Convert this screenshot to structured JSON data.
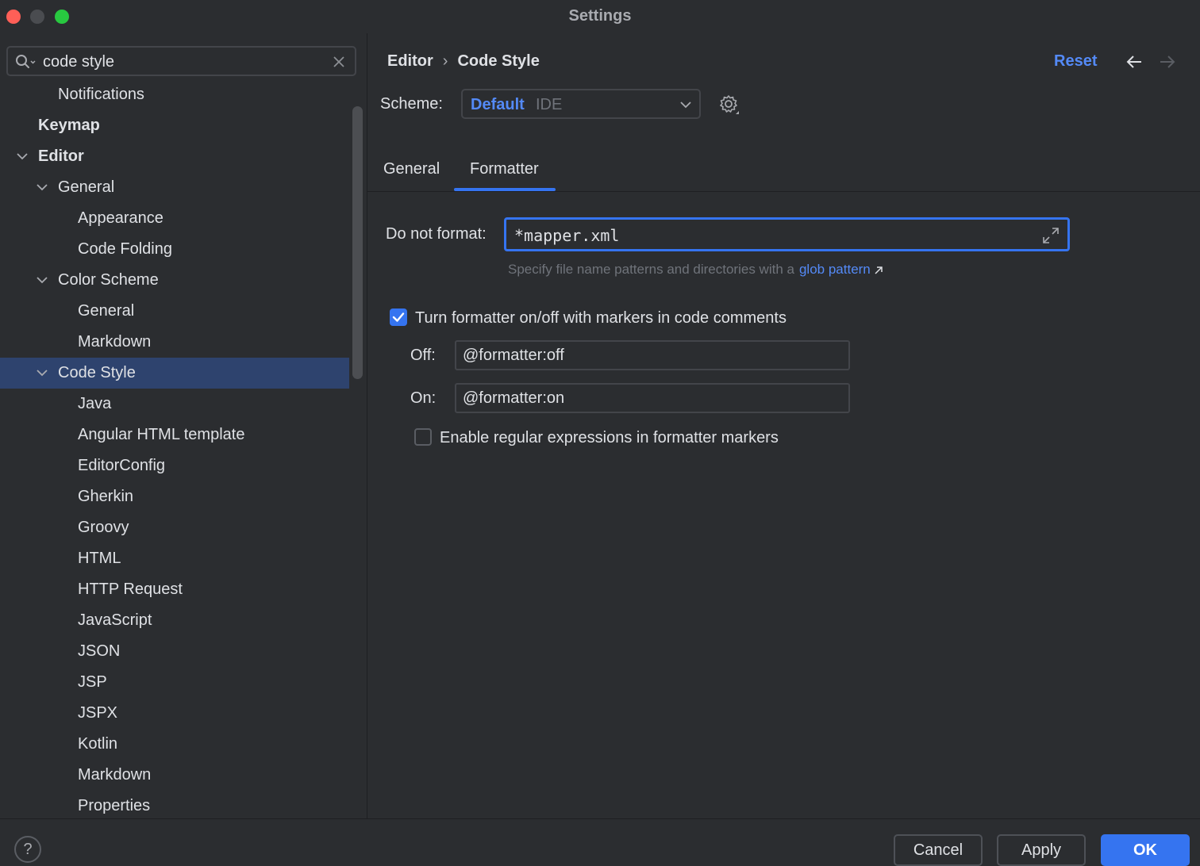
{
  "window": {
    "title": "Settings"
  },
  "search": {
    "value": "code style"
  },
  "tree": {
    "items": [
      {
        "label": "Notifications",
        "level": 2,
        "bold": false,
        "expanded": null,
        "selected": false
      },
      {
        "label": "Keymap",
        "level": 1,
        "bold": true,
        "expanded": null,
        "selected": false
      },
      {
        "label": "Editor",
        "level": 1,
        "bold": true,
        "expanded": true,
        "selected": false
      },
      {
        "label": "General",
        "level": 2,
        "bold": false,
        "expanded": true,
        "selected": false
      },
      {
        "label": "Appearance",
        "level": 3,
        "bold": false,
        "expanded": null,
        "selected": false
      },
      {
        "label": "Code Folding",
        "level": 3,
        "bold": false,
        "expanded": null,
        "selected": false
      },
      {
        "label": "Color Scheme",
        "level": 2,
        "bold": false,
        "expanded": true,
        "selected": false
      },
      {
        "label": "General",
        "level": 3,
        "bold": false,
        "expanded": null,
        "selected": false
      },
      {
        "label": "Markdown",
        "level": 3,
        "bold": false,
        "expanded": null,
        "selected": false
      },
      {
        "label": "Code Style",
        "level": 2,
        "bold": false,
        "expanded": true,
        "selected": true
      },
      {
        "label": "Java",
        "level": 3,
        "bold": false,
        "expanded": null,
        "selected": false
      },
      {
        "label": "Angular HTML template",
        "level": 3,
        "bold": false,
        "expanded": null,
        "selected": false
      },
      {
        "label": "EditorConfig",
        "level": 3,
        "bold": false,
        "expanded": null,
        "selected": false
      },
      {
        "label": "Gherkin",
        "level": 3,
        "bold": false,
        "expanded": null,
        "selected": false
      },
      {
        "label": "Groovy",
        "level": 3,
        "bold": false,
        "expanded": null,
        "selected": false
      },
      {
        "label": "HTML",
        "level": 3,
        "bold": false,
        "expanded": null,
        "selected": false
      },
      {
        "label": "HTTP Request",
        "level": 3,
        "bold": false,
        "expanded": null,
        "selected": false
      },
      {
        "label": "JavaScript",
        "level": 3,
        "bold": false,
        "expanded": null,
        "selected": false
      },
      {
        "label": "JSON",
        "level": 3,
        "bold": false,
        "expanded": null,
        "selected": false
      },
      {
        "label": "JSP",
        "level": 3,
        "bold": false,
        "expanded": null,
        "selected": false
      },
      {
        "label": "JSPX",
        "level": 3,
        "bold": false,
        "expanded": null,
        "selected": false
      },
      {
        "label": "Kotlin",
        "level": 3,
        "bold": false,
        "expanded": null,
        "selected": false
      },
      {
        "label": "Markdown",
        "level": 3,
        "bold": false,
        "expanded": null,
        "selected": false
      },
      {
        "label": "Properties",
        "level": 3,
        "bold": false,
        "expanded": null,
        "selected": false
      }
    ]
  },
  "breadcrumb": {
    "parent": "Editor",
    "separator": "›",
    "current": "Code Style"
  },
  "header": {
    "reset_label": "Reset"
  },
  "scheme": {
    "label": "Scheme:",
    "name": "Default",
    "kind": "IDE"
  },
  "tabs": [
    {
      "label": "General",
      "active": false
    },
    {
      "label": "Formatter",
      "active": true
    }
  ],
  "formatter": {
    "do_not_format_label": "Do not format:",
    "do_not_format_value": "*mapper.xml",
    "hint_text": "Specify file name patterns and directories with a",
    "hint_link": "glob pattern",
    "markers_checkbox_label": "Turn formatter on/off with markers in code comments",
    "markers_checked": true,
    "off_label": "Off:",
    "off_value": "@formatter:off",
    "on_label": "On:",
    "on_value": "@formatter:on",
    "regex_checkbox_label": "Enable regular expressions in formatter markers",
    "regex_checked": false
  },
  "footer": {
    "help_label": "?",
    "cancel_label": "Cancel",
    "apply_label": "Apply",
    "ok_label": "OK"
  },
  "colors": {
    "background": "#2b2d30",
    "accent": "#3574f0",
    "link": "#548af7",
    "selection": "#2e436e"
  }
}
